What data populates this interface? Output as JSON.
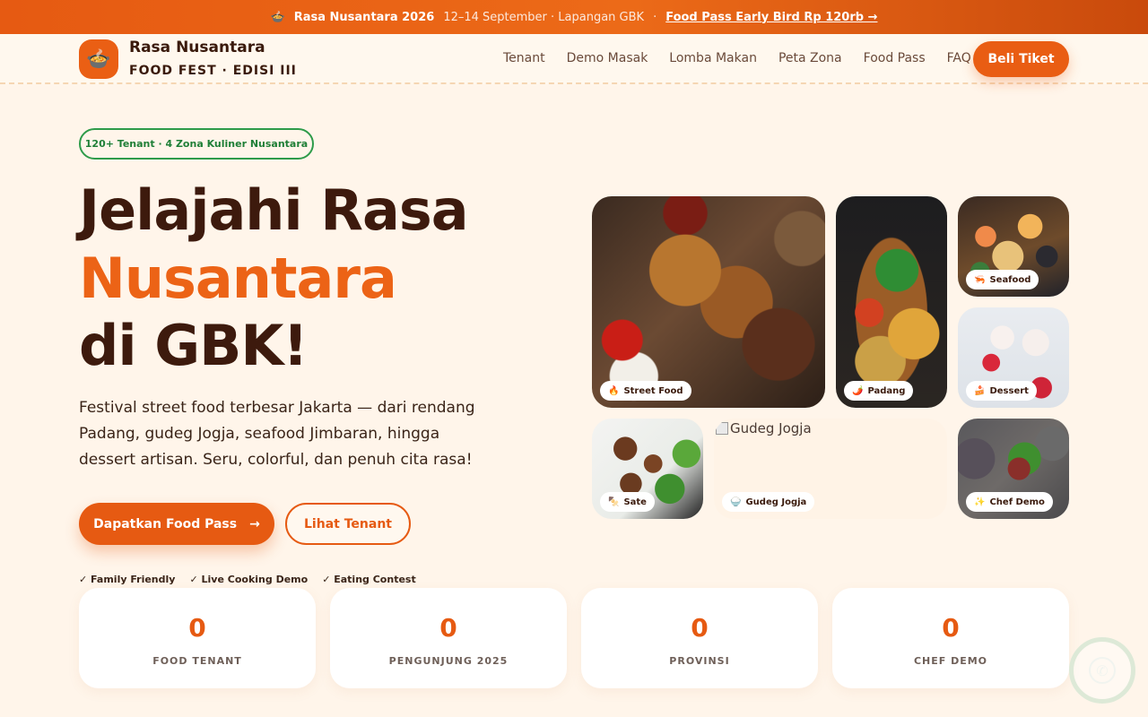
{
  "announcement": {
    "icon": "🍲",
    "event": "Rasa Nusantara 2026",
    "date_place": "12–14 September · Lapangan GBK",
    "dot": "·",
    "link": "Food Pass Early Bird Rp 120rb →"
  },
  "brand": {
    "logo_icon": "🍲",
    "name": "Rasa Nusantara",
    "subtitle": "FOOD FEST · EDISI III"
  },
  "nav": {
    "items": [
      "Tenant",
      "Demo Masak",
      "Lomba Makan",
      "Peta Zona",
      "Food Pass",
      "FAQ"
    ],
    "cta": "Beli Tiket"
  },
  "hero": {
    "pill": "120+ Tenant · 4 Zona Kuliner Nusantara",
    "title_line1": "Jelajahi Rasa",
    "title_line2": "Nusantara",
    "title_line3": "di GBK!",
    "lead": "Festival street food terbesar Jakarta — dari rendang Padang, gudeg Jogja, seafood Jimbaran, hingga dessert artisan. Seru, colorful, dan penuh cita rasa!",
    "primary_button": "Dapatkan Food Pass",
    "primary_arrow": "→",
    "secondary_button": "Lihat Tenant",
    "features": [
      "✓  Family Friendly",
      "✓  Live Cooking Demo",
      "✓  Eating Contest"
    ]
  },
  "gallery": {
    "street": {
      "icon": "🔥",
      "label": "Street Food"
    },
    "padang": {
      "icon": "🌶️",
      "label": "Padang"
    },
    "seafood": {
      "icon": "🦐",
      "label": "Seafood"
    },
    "dessert": {
      "icon": "🍰",
      "label": "Dessert"
    },
    "sate": {
      "icon": "🍢",
      "label": "Sate"
    },
    "gudeg": {
      "icon": "🍚",
      "label": "Gudeg Jogja",
      "alt_text": "Gudeg Jogja"
    },
    "chef": {
      "icon": "✨",
      "label": "Chef Demo"
    }
  },
  "stats": [
    {
      "value": "0",
      "label": "FOOD TENANT"
    },
    {
      "value": "0",
      "label": "PENGUNJUNG 2025"
    },
    {
      "value": "0",
      "label": "PROVINSI"
    },
    {
      "value": "0",
      "label": "CHEF DEMO"
    }
  ],
  "chat_icon": "whatsapp-icon",
  "colors": {
    "accent": "#e65a12",
    "dark": "#3d1a0d",
    "green": "#2e9b4a",
    "background": "#fff5ea"
  }
}
